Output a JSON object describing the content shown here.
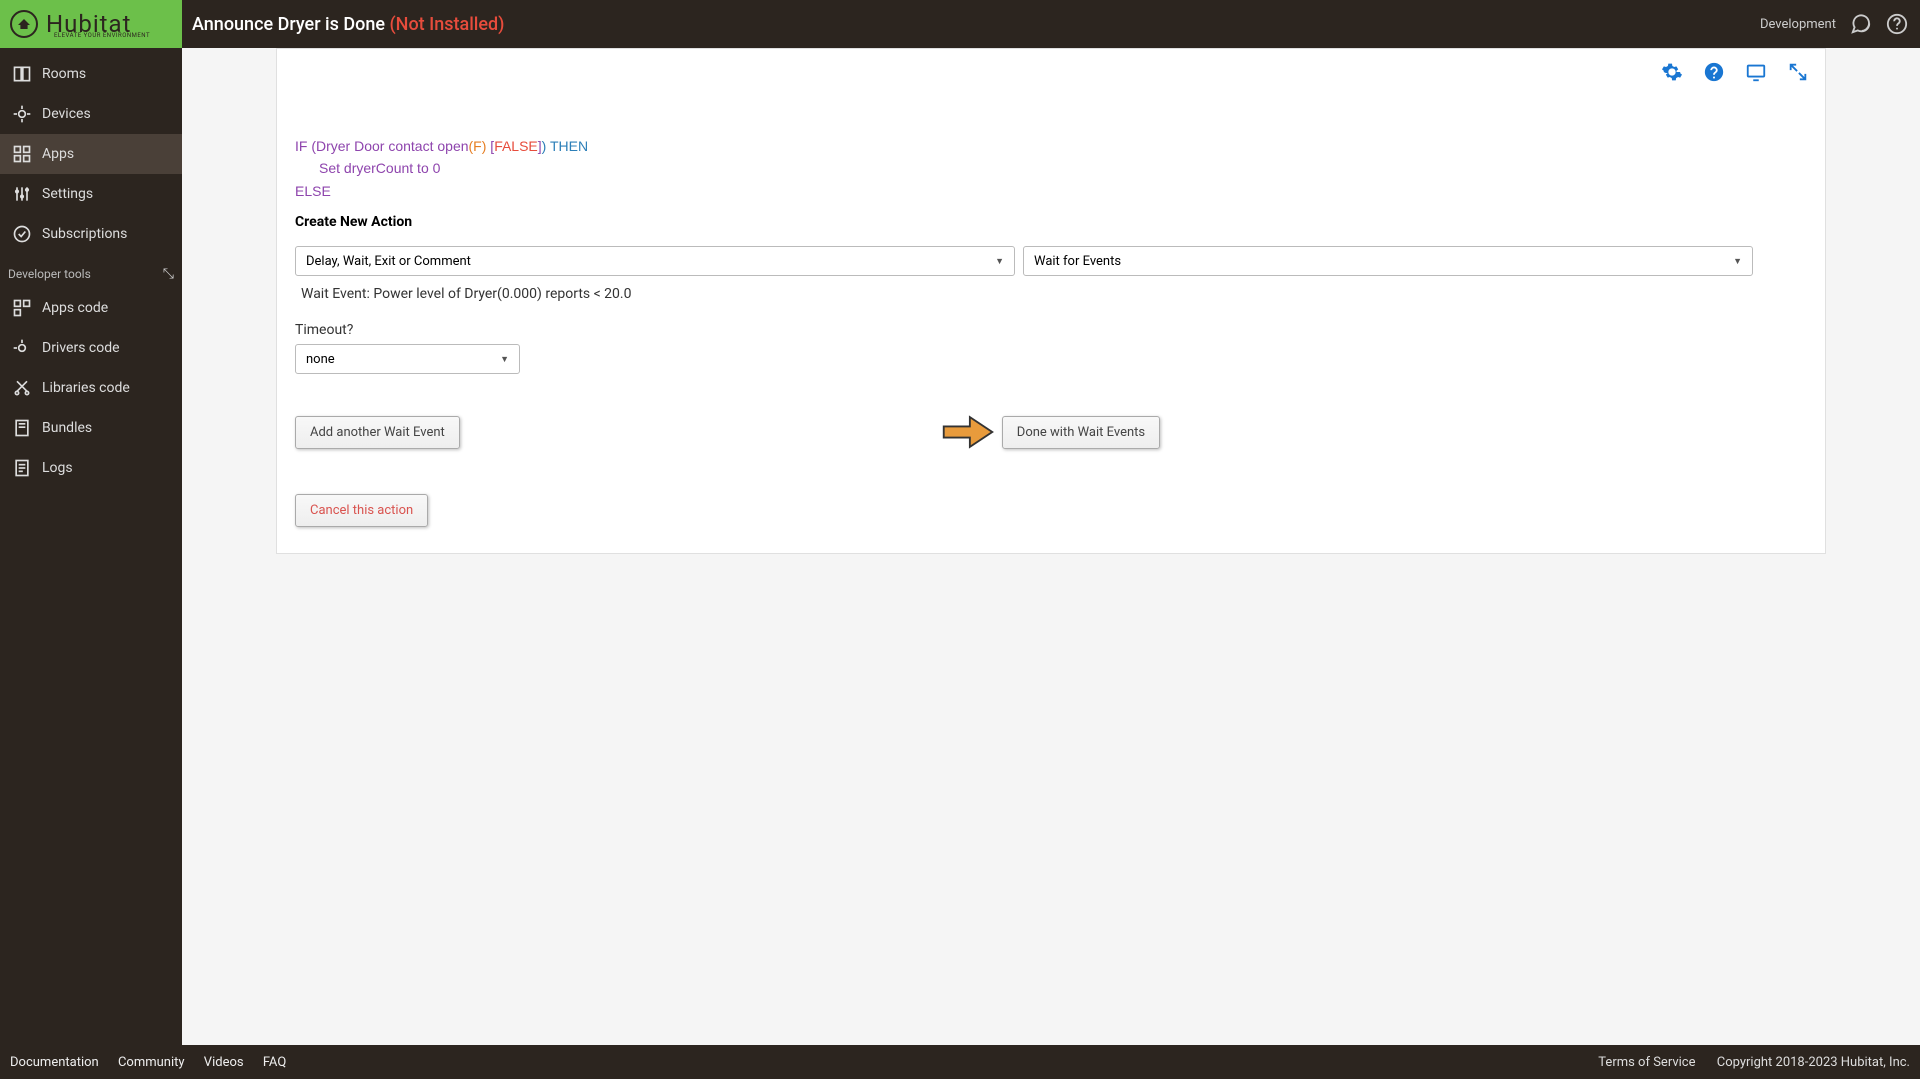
{
  "header": {
    "brand_main": "Hubitat",
    "brand_sub": "ELEVATE YOUR ENVIRONMENT",
    "title": "Announce Dryer is Done ",
    "title_suffix": "(Not Installed)",
    "dev_label": "Development"
  },
  "sidebar": {
    "items": [
      {
        "label": "Rooms"
      },
      {
        "label": "Devices"
      },
      {
        "label": "Apps"
      },
      {
        "label": "Settings"
      },
      {
        "label": "Subscriptions"
      }
    ],
    "section_label": "Developer tools",
    "dev_items": [
      {
        "label": "Apps code"
      },
      {
        "label": "Drivers code"
      },
      {
        "label": "Libraries code"
      },
      {
        "label": "Bundles"
      },
      {
        "label": "Logs"
      }
    ]
  },
  "rule": {
    "if_prefix": "IF (Dryer Door contact open",
    "if_f": "(F)",
    "if_bracket_open": " [",
    "if_false": "FALSE",
    "if_bracket_close": "]",
    "if_then": ") THEN",
    "set_line": "Set dryerCount to 0",
    "else_line": "ELSE"
  },
  "form": {
    "create_label": "Create New Action",
    "drop1": "Delay, Wait, Exit or Comment",
    "drop2": "Wait for Events",
    "wait_line": "Wait Event: Power level of Dryer(0.000) reports < 20.0",
    "timeout_label": "Timeout?",
    "timeout_value": "none",
    "add_btn": "Add another Wait Event",
    "done_btn": "Done with Wait Events",
    "cancel_btn": "Cancel this action"
  },
  "footer": {
    "links": [
      "Documentation",
      "Community",
      "Videos",
      "FAQ"
    ],
    "tos": "Terms of Service",
    "copyright": "Copyright 2018-2023 Hubitat, Inc."
  }
}
